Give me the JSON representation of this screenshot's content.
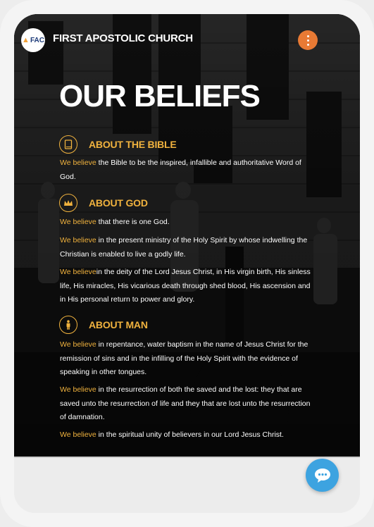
{
  "header": {
    "logo_text": "FAC",
    "site_title": "FIRST APOSTOLIC CHURCH",
    "menu_icon": "kebab-menu-icon"
  },
  "page": {
    "heading": "OUR BELIEFS"
  },
  "sections": [
    {
      "icon": "book-icon",
      "title": "ABOUT THE BIBLE",
      "paragraphs": [
        {
          "lead": "We believe",
          "text": " the Bible to be the inspired, infallible and authoritative Word of God."
        }
      ]
    },
    {
      "icon": "crown-icon",
      "title": "ABOUT GOD",
      "paragraphs": [
        {
          "lead": "We believe",
          "text": " that there is one God."
        },
        {
          "lead": "We believe",
          "text": " in the present ministry of the Holy Spirit by whose indwelling the Christian is enabled to live a godly life."
        },
        {
          "lead": "We believe",
          "text": "in the deity of the Lord Jesus Christ, in His virgin birth, His sinless life, His miracles, His vicarious death through shed blood, His ascension and in His personal return to power and glory."
        }
      ]
    },
    {
      "icon": "person-icon",
      "title": "ABOUT MAN",
      "paragraphs": [
        {
          "lead": "We believe",
          "text": " in repentance, water baptism in the name of Jesus Christ for the remission of sins and in the infilling of the Holy Spirit with the evidence of speaking in other tongues."
        },
        {
          "lead": "We believe",
          "text": " in the resurrection of both the saved and the lost: they that are saved unto the resurrection of life and they that are lost unto the resurrection of damnation."
        },
        {
          "lead": "We believe",
          "text": " in the spiritual unity of believers in our Lord Jesus Christ."
        }
      ]
    }
  ],
  "chat": {
    "icon": "chat-bubble-icon"
  },
  "colors": {
    "accent": "#f0b23e",
    "menu_button": "#e87a34",
    "chat_button": "#3da3e0"
  }
}
